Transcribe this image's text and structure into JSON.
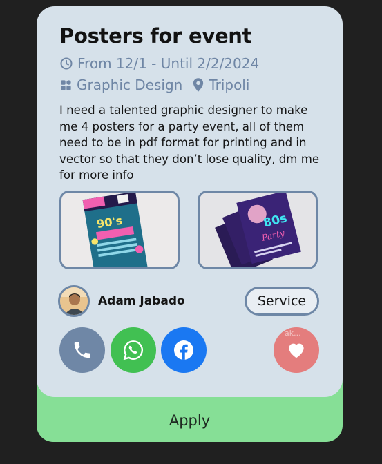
{
  "post": {
    "title": "Posters for event",
    "dates": "From 12/1 - Until 2/2/2024",
    "category": "Graphic Design",
    "location": "Tripoli",
    "description": "I need a talented graphic designer to make me 4 posters for a party event, all of them need to be in pdf format for printing and in vector so that they don’t lose quality, dm me for more info",
    "images": [
      "poster-90s-icon",
      "poster-80s-party-icon"
    ]
  },
  "author": {
    "name": "Adam Jabado",
    "type_label": "Service"
  },
  "contact": {
    "favorite_hint": "ak..."
  },
  "footer": {
    "apply_label": "Apply"
  },
  "colors": {
    "card_bg": "#d6e1ea",
    "accent": "#6f86a5",
    "apply_bg": "#86df96",
    "whatsapp": "#41c052",
    "facebook": "#1a78f2",
    "favorite": "#e47d7d"
  }
}
